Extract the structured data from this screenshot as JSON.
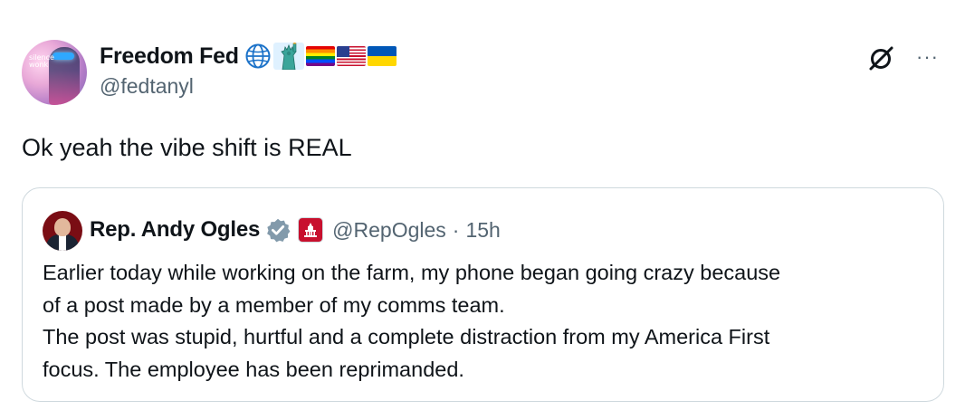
{
  "post": {
    "author": {
      "display_name": "Freedom Fed",
      "handle": "@fedtanyl",
      "avatar_text": "silence\nwonk",
      "name_emojis": [
        "globe-icon",
        "statue-of-liberty-icon",
        "rainbow-flag-icon",
        "us-flag-icon",
        "ukraine-flag-icon"
      ]
    },
    "text": "Ok yeah the vibe shift is REAL",
    "actions": {
      "grok_icon": "grok-icon",
      "more_label": "···"
    }
  },
  "quoted_post": {
    "author": {
      "display_name": "Rep. Andy Ogles",
      "handle": "@RepOgles",
      "separator": "·",
      "time": "15h",
      "verified_badge": "verified-badge-icon",
      "affiliation_badge": "us-house-icon"
    },
    "body_lines": [
      "Earlier today while working on the farm, my phone began going crazy because",
      "of a post made by a member of my comms team.",
      "The post was stupid, hurtful and a complete distraction from my America First",
      "focus. The employee has been reprimanded."
    ]
  },
  "colors": {
    "text_primary": "#0f1419",
    "text_secondary": "#536471",
    "border": "#cfd9de",
    "verified_gray": "#829aab",
    "house_red": "#c8102e"
  }
}
